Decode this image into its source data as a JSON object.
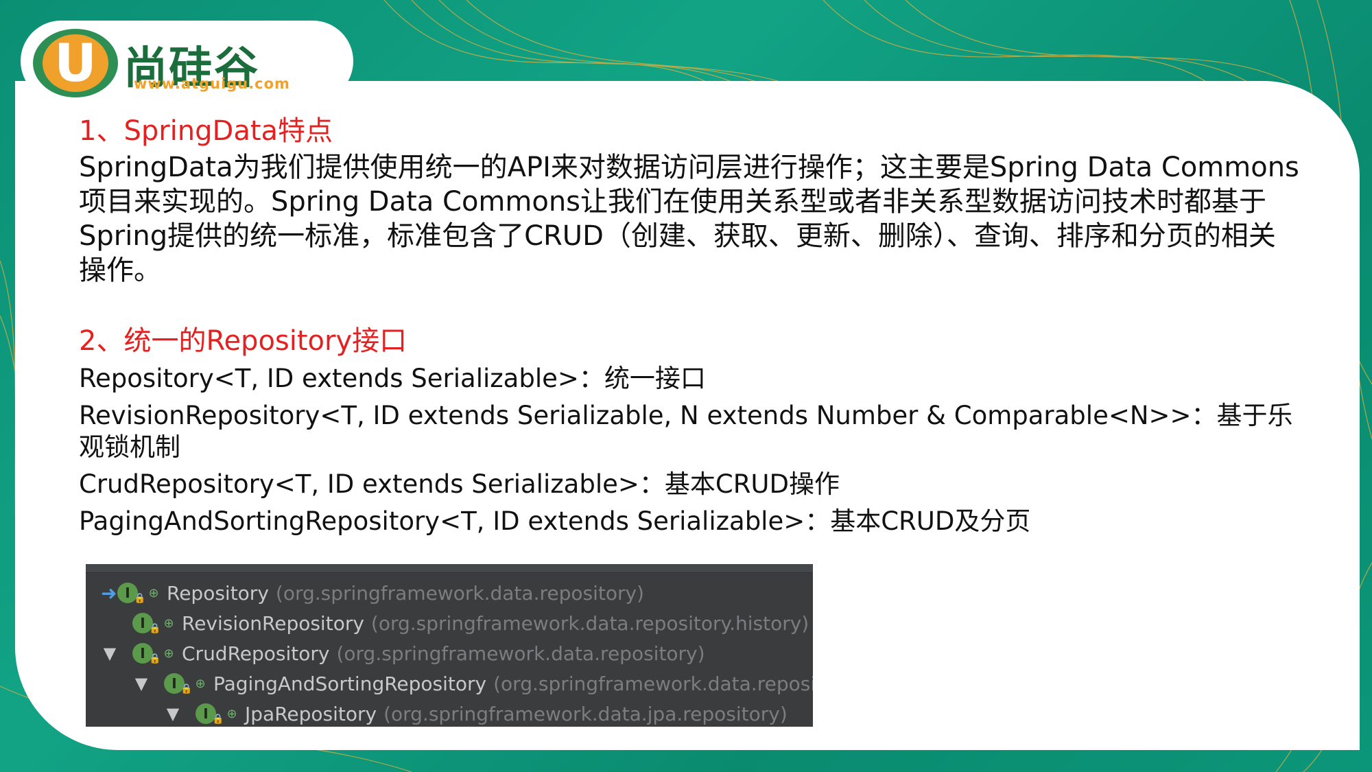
{
  "logo": {
    "badge_letter": "U",
    "brand_cn": "尚硅谷",
    "url": "www.atguigu.com"
  },
  "section1": {
    "heading": "1、SpringData特点",
    "paragraph": "SpringData为我们提供使用统一的API来对数据访问层进行操作；这主要是Spring Data Commons项目来实现的。Spring Data Commons让我们在使用关系型或者非关系型数据访问技术时都基于Spring提供的统一标准，标准包含了CRUD（创建、获取、更新、删除）、查询、排序和分页的相关操作。"
  },
  "section2": {
    "heading": "2、统一的Repository接口",
    "lines": [
      "Repository<T, ID extends Serializable>：统一接口",
      "RevisionRepository<T, ID extends Serializable, N extends Number & Comparable<N>>：基于乐观锁机制",
      "CrudRepository<T, ID extends Serializable>：基本CRUD操作",
      "PagingAndSortingRepository<T, ID extends Serializable>：基本CRUD及分页"
    ]
  },
  "ide_tree": {
    "rows": [
      {
        "class": "Repository",
        "package": "(org.springframework.data.repository)",
        "badge": "I",
        "marker": "arrow"
      },
      {
        "class": "RevisionRepository",
        "package": "(org.springframework.data.repository.history)",
        "badge": "I",
        "marker": ""
      },
      {
        "class": "CrudRepository",
        "package": "(org.springframework.data.repository)",
        "badge": "I",
        "marker": "expanded"
      },
      {
        "class": "PagingAndSortingRepository",
        "package": "(org.springframework.data.reposito",
        "badge": "I",
        "marker": "expanded"
      },
      {
        "class": "JpaRepository",
        "package": "(org.springframework.data.jpa.repository)",
        "badge": "I",
        "marker": "expanded"
      }
    ],
    "expand_glyph": "▼",
    "arrow_glyph": "➜"
  },
  "colors": {
    "background": "#0b8f74",
    "heading": "#e52020",
    "text": "#111111",
    "ide_bg": "#3a3c3e",
    "brand_orange": "#f0a12b",
    "brand_green": "#1b6d3b"
  }
}
